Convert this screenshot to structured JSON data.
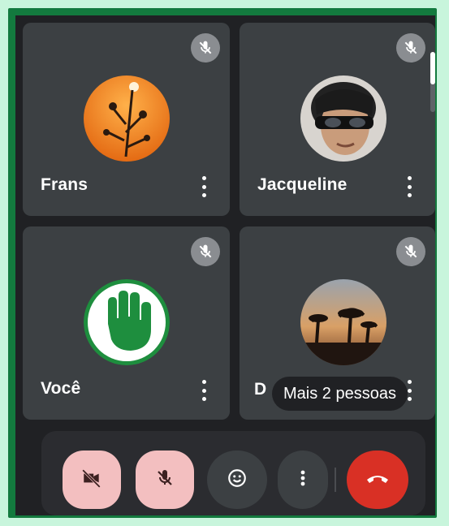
{
  "participants": [
    {
      "name": "Frans",
      "muted": true,
      "avatar": "flower-silhouette-avatar"
    },
    {
      "name": "Jacqueline",
      "muted": true,
      "avatar": "person-sunglasses-avatar"
    },
    {
      "name": "Você",
      "muted": true,
      "avatar": "raised-hand-avatar"
    },
    {
      "name": "D",
      "muted": true,
      "avatar": "sunset-trees-avatar"
    }
  ],
  "tooltip": {
    "text": "Mais 2 pessoas"
  },
  "controls": {
    "camera": "camera-off-icon",
    "mic": "mic-off-icon",
    "reactions": "emoji-icon",
    "more": "more-options-icon",
    "hangup": "hangup-icon"
  },
  "colors": {
    "frame": "#137a3e",
    "tile": "#3c4043",
    "background": "#202124",
    "pink_button": "#f3bfc0",
    "hangup": "#d93025"
  }
}
